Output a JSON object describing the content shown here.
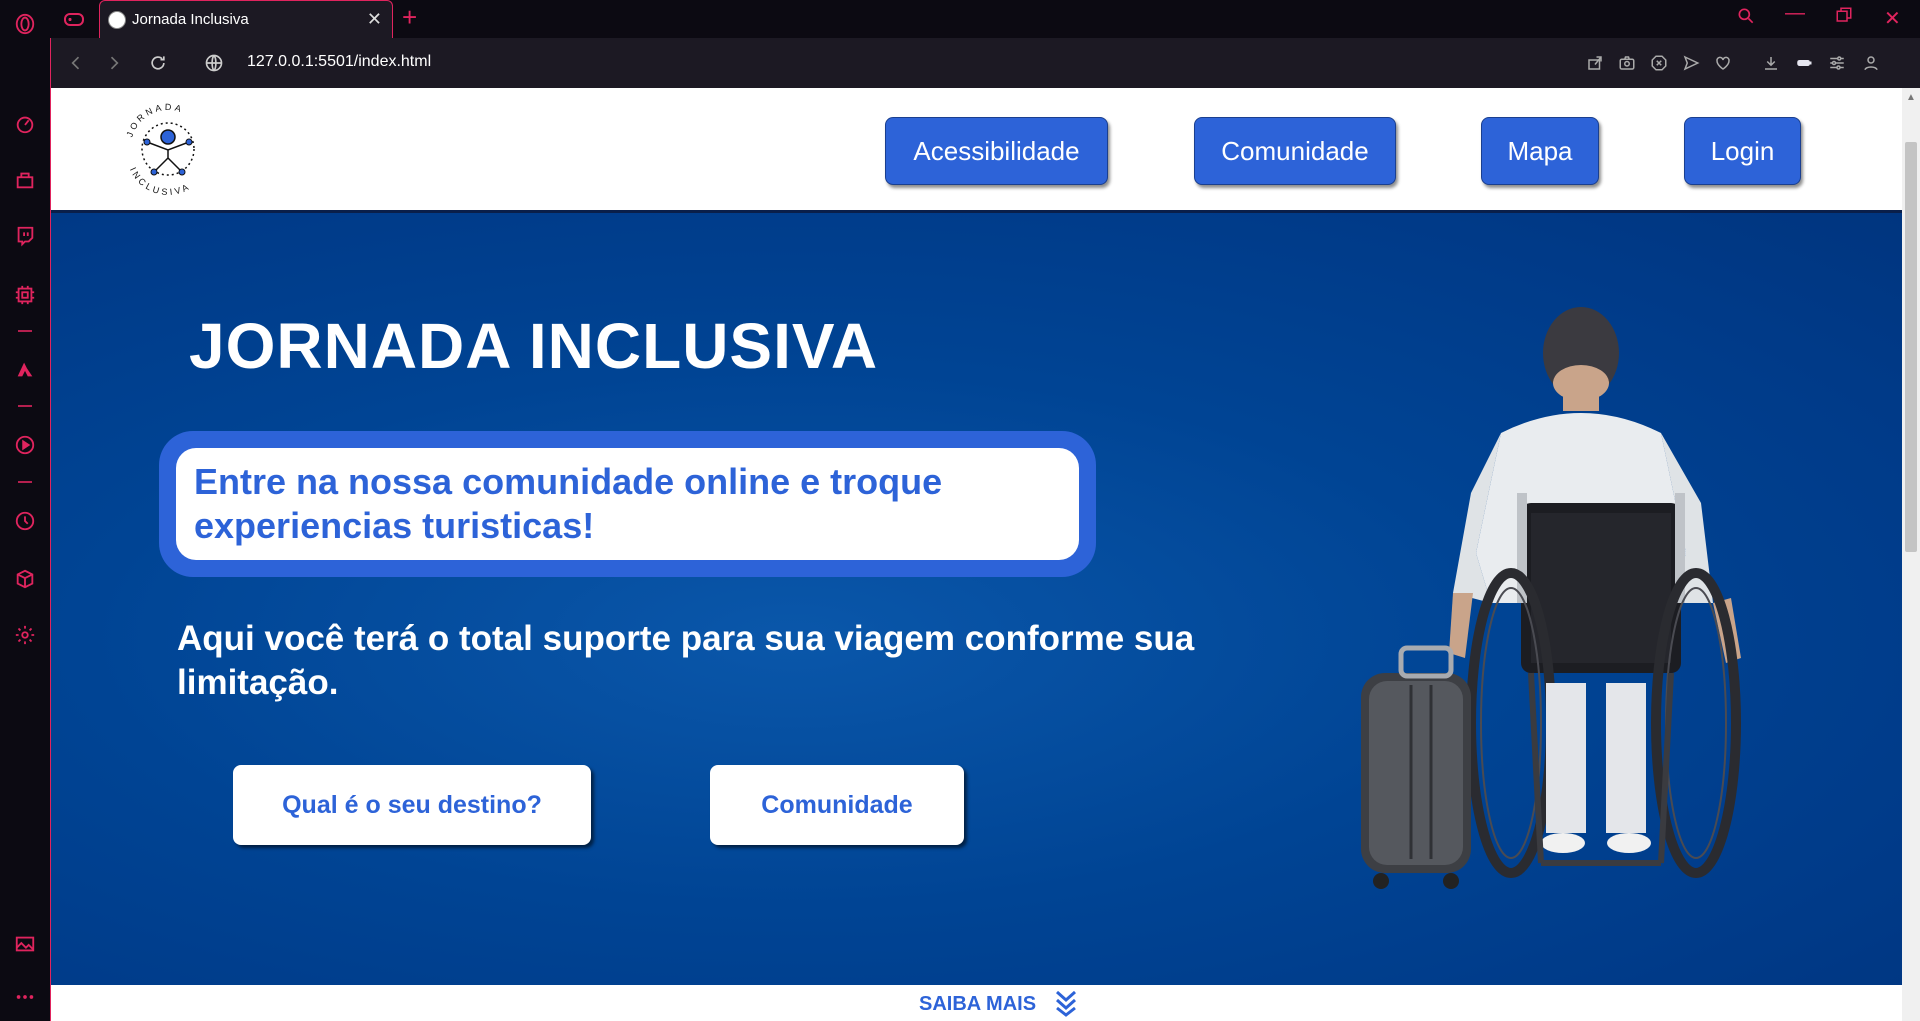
{
  "browser": {
    "tab_title": "Jornada Inclusiva",
    "url": "127.0.0.1:5501/index.html",
    "accent_color": "#e0245e"
  },
  "header": {
    "logo_text_top": "JORNADA",
    "logo_text_bottom": "INCLUSIVA",
    "nav": [
      "Acessibilidade",
      "Comunidade",
      "Mapa",
      "Login"
    ]
  },
  "hero": {
    "title": "JORNADA INCLUSIVA",
    "promo": "Entre na nossa comunidade online e troque experiencias turisticas!",
    "subtitle": "Aqui você terá o total suporte para sua viagem conforme sua limitação.",
    "cta_primary": "Qual é o seu destino?",
    "cta_secondary": "Comunidade"
  },
  "footer": {
    "saiba_mais": "SAIBA MAIS"
  },
  "colors": {
    "brand_blue": "#2d63d8",
    "hero_bg": "#004494"
  }
}
